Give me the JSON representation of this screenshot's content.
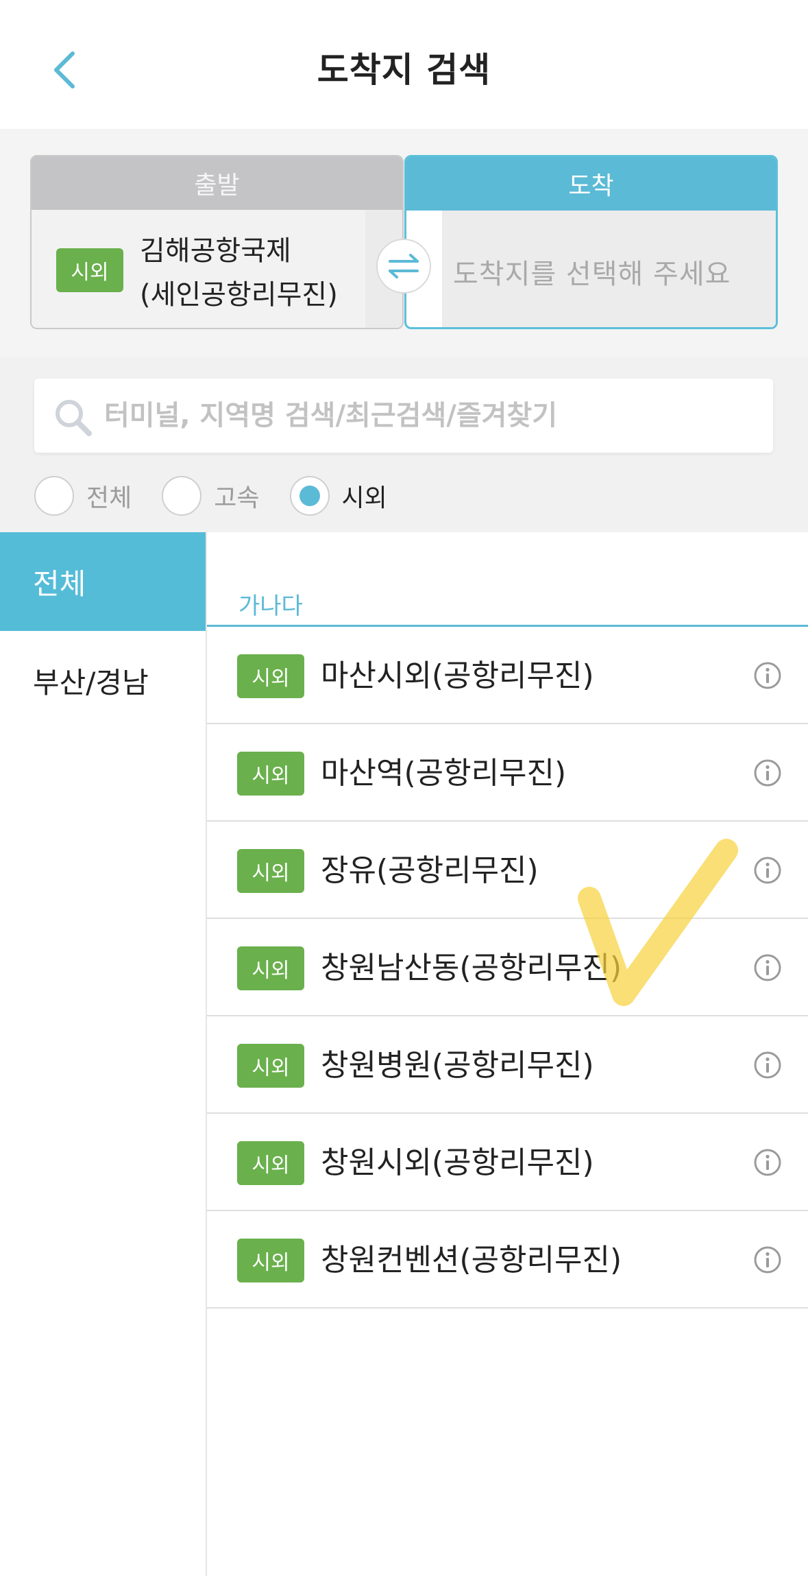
{
  "header": {
    "title": "도착지 검색"
  },
  "route": {
    "departure": {
      "header": "출발",
      "badge": "시외",
      "name_line1": "김해공항국제",
      "name_line2": "(세인공항리무진)"
    },
    "arrival": {
      "header": "도착",
      "placeholder": "도착지를 선택해 주세요"
    }
  },
  "search": {
    "placeholder": "터미널, 지역명 검색/최근검색/즐겨찾기"
  },
  "filters": [
    {
      "label": "전체",
      "selected": false
    },
    {
      "label": "고속",
      "selected": false
    },
    {
      "label": "시외",
      "selected": true
    }
  ],
  "sidebar": {
    "items": [
      {
        "label": "전체",
        "active": true
      },
      {
        "label": "부산/경남",
        "active": false
      }
    ]
  },
  "list": {
    "section_label": "가나다",
    "items": [
      {
        "badge": "시외",
        "name": "마산시외(공항리무진)"
      },
      {
        "badge": "시외",
        "name": "마산역(공항리무진)"
      },
      {
        "badge": "시외",
        "name": "장유(공항리무진)"
      },
      {
        "badge": "시외",
        "name": "창원남산동(공항리무진)"
      },
      {
        "badge": "시외",
        "name": "창원병원(공항리무진)"
      },
      {
        "badge": "시외",
        "name": "창원시외(공항리무진)"
      },
      {
        "badge": "시외",
        "name": "창원컨벤션(공항리무진)"
      }
    ]
  },
  "colors": {
    "accent": "#5bbad6",
    "badge_green": "#6ab04c",
    "highlight_mark": "#f6d13a"
  }
}
